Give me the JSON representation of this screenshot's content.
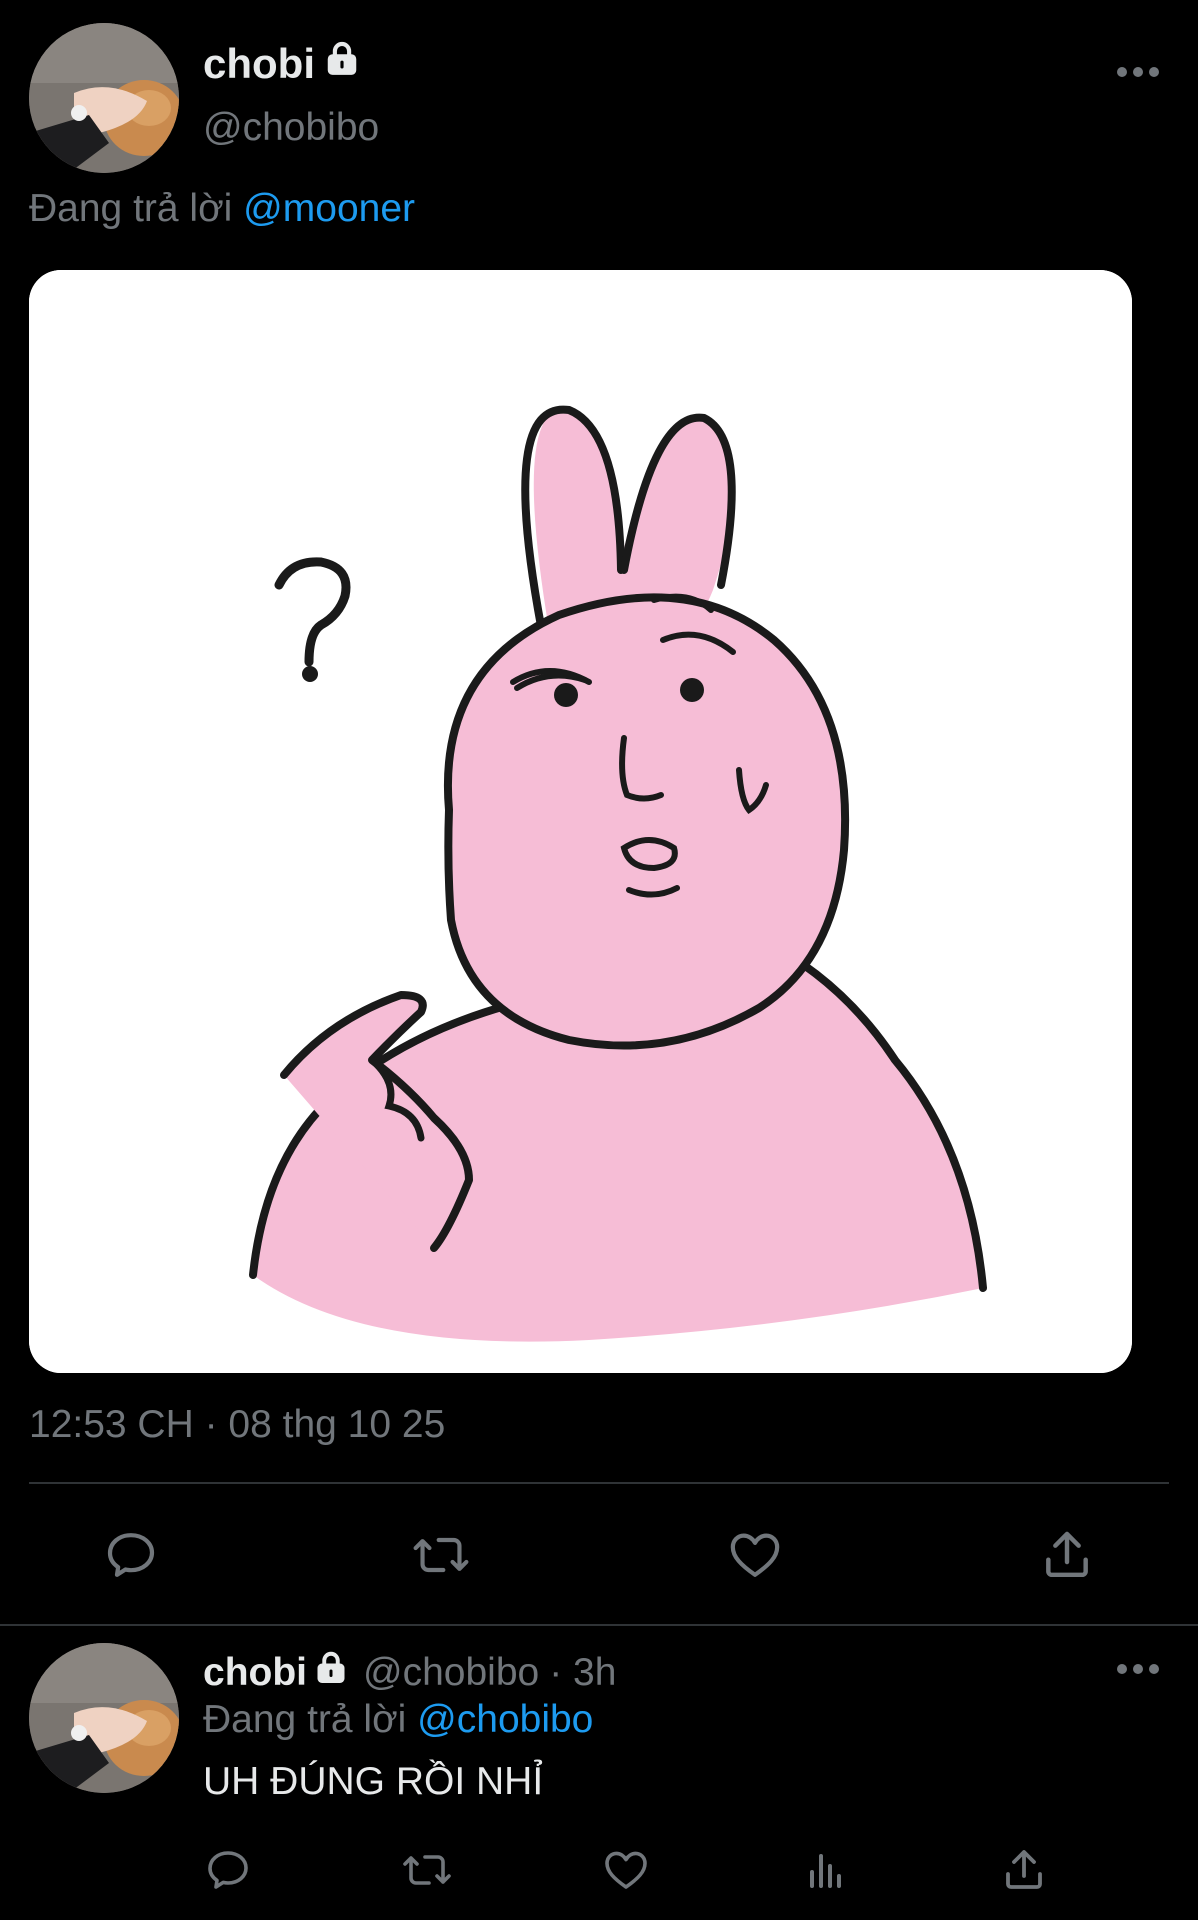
{
  "main_tweet": {
    "author_name": "chobi",
    "author_handle": "@chobibo",
    "replying_prefix": "Đang trả lời",
    "replying_to": "@mooner",
    "timestamp": "12:53 CH · 08 thg 10 25",
    "media_description": "pink bunny sticker with question mark",
    "actions": [
      "reply-icon",
      "retweet-icon",
      "like-icon",
      "share-icon"
    ]
  },
  "reply_tweet": {
    "author_name": "chobi",
    "author_handle": "@chobibo",
    "time_ago": "· 3h",
    "replying_prefix": "Đang trả lời",
    "replying_to": "@chobibo",
    "text": "UH ĐÚNG RỒI NHỈ",
    "actions": [
      "reply-icon",
      "retweet-icon",
      "like-icon",
      "analytics-icon",
      "share-icon"
    ]
  },
  "colors": {
    "background": "#000000",
    "text_primary": "#e7e9ea",
    "text_secondary": "#71767b",
    "accent": "#1d9bf0",
    "divider": "#2f3336",
    "bunny_pink": "#f6bdd6"
  }
}
